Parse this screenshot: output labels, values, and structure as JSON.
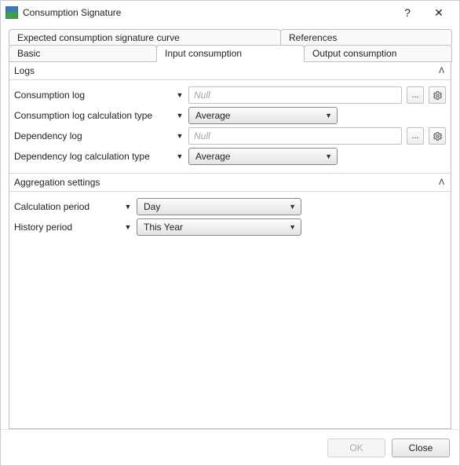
{
  "window": {
    "title": "Consumption Signature",
    "help_glyph": "?",
    "close_glyph": "✕"
  },
  "tabs": {
    "top": [
      {
        "label": "Expected consumption signature curve"
      },
      {
        "label": "References"
      }
    ],
    "bottom": [
      {
        "label": "Basic"
      },
      {
        "label": "Input consumption"
      },
      {
        "label": "Output consumption"
      }
    ],
    "active": "Input consumption"
  },
  "sections": {
    "logs": {
      "title": "Logs",
      "rows": {
        "consumption_log": {
          "label": "Consumption log",
          "value": "Null"
        },
        "consumption_log_calc_type": {
          "label": "Consumption log calculation type",
          "value": "Average"
        },
        "dependency_log": {
          "label": "Dependency log",
          "value": "Null"
        },
        "dependency_log_calc_type": {
          "label": "Dependency log calculation type",
          "value": "Average"
        }
      }
    },
    "aggregation": {
      "title": "Aggregation settings",
      "rows": {
        "calculation_period": {
          "label": "Calculation period",
          "value": "Day"
        },
        "history_period": {
          "label": "History period",
          "value": "This Year"
        }
      }
    }
  },
  "icons": {
    "ellipsis": "...",
    "caret": "▼",
    "chevron_up": "ᐱ"
  },
  "footer": {
    "ok": "OK",
    "close": "Close"
  }
}
